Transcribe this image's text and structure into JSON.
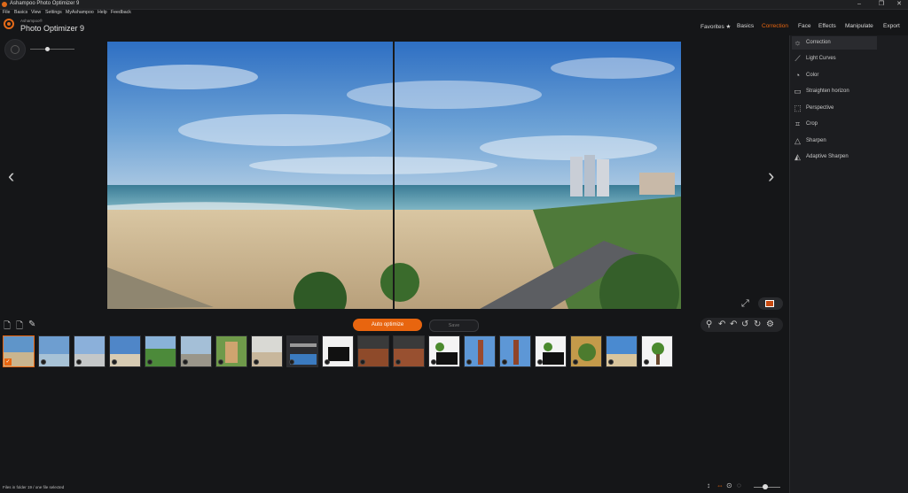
{
  "window": {
    "title": "Ashampoo Photo Optimizer 9"
  },
  "menu": [
    "File",
    "Basics",
    "View",
    "Settings",
    "MyAshampoo",
    "Help",
    "Feedback"
  ],
  "brand": {
    "small": "Ashampoo®",
    "name": "Photo Optimizer 9"
  },
  "topnav": [
    "Favorites ★",
    "Basics",
    "Correction",
    "Face",
    "Effects",
    "Manipulate",
    "Export"
  ],
  "topnav_active": "Correction",
  "accent_color": "#e8650f",
  "correction_panel": [
    {
      "label": "Correction",
      "icon": "sun-icon"
    },
    {
      "label": "Light Curves",
      "icon": "curves-icon"
    },
    {
      "label": "Color",
      "icon": "palette-icon"
    },
    {
      "label": "Straighten horizon",
      "icon": "horizon-icon"
    },
    {
      "label": "Perspective",
      "icon": "perspective-icon"
    },
    {
      "label": "Crop",
      "icon": "crop-icon"
    },
    {
      "label": "Sharpen",
      "icon": "triangle-icon"
    },
    {
      "label": "Adaptive Sharpen",
      "icon": "triangle-icon"
    }
  ],
  "actions": {
    "auto_optimize": "Auto optimize",
    "save": "Save"
  },
  "status_text": "Files in folder 19 / one file selected"
}
